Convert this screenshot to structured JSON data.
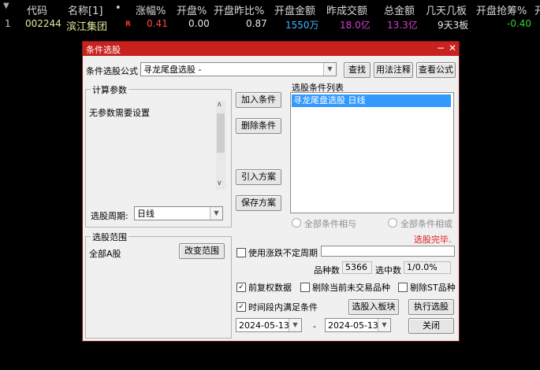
{
  "grid": {
    "headers": [
      "代码",
      "名称[1]",
      "•",
      "涨幅%",
      "开盘%",
      "开盘昨比%",
      "开盘金额",
      "昨成交额",
      "总金额",
      "几天几板",
      "开盘抢筹%",
      "开"
    ],
    "row": {
      "index": "1",
      "code": "002244",
      "name": "滨江集团",
      "flag": "R",
      "change_pct": "0.41",
      "open_pct": "0.00",
      "open_vs_yesterday": "0.87",
      "open_amount": "1550万",
      "yesterday_turnover": "18.0亿",
      "total_amount": "13.3亿",
      "board_days": "9天3板",
      "open_grab_pct": "-0.40"
    }
  },
  "dialog": {
    "title": "条件选股",
    "formula_label": "条件选股公式",
    "formula_value": "寻龙尾盘选股  -",
    "btn_find": "查找",
    "btn_usage": "用法注释",
    "btn_view_formula": "查看公式",
    "params_group": "计算参数",
    "params_text": "无参数需要设置",
    "period_label": "选股周期:",
    "period_value": "日线",
    "btn_add": "加入条件",
    "btn_delete": "删除条件",
    "btn_import": "引入方案",
    "btn_save": "保存方案",
    "list_label": "选股条件列表",
    "list_items": [
      "寻龙尾盘选股  日线"
    ],
    "radio_and": "全部条件相与",
    "radio_or": "全部条件相或",
    "status": "选股完毕.",
    "range_group": "选股范围",
    "range_value": "全部A股",
    "btn_change_range": "改变范围",
    "chk_uncertain_period": "使用涨跌不定周期",
    "count_label": "品种数",
    "count_value": "5366",
    "selected_label": "选中数",
    "selected_value": "1/0.0%",
    "chk_prev_adjust": "前复权数据",
    "chk_exclude_untraded": "剔除当前未交易品种",
    "chk_exclude_st": "剔除ST品种",
    "chk_time_range": "时间段内满足条件",
    "btn_to_block": "选股入板块",
    "btn_run": "执行选股",
    "date_from": "2024-05-13",
    "date_sep": "-",
    "date_to": "2024-05-13",
    "btn_close": "关闭"
  },
  "colors": {
    "dialog_title_bg": "#c9211e",
    "up": "#ff4a4a",
    "down": "#33cc33",
    "amount": "#3fb7ff",
    "yi": "#d040d0",
    "status": "#e02020"
  }
}
